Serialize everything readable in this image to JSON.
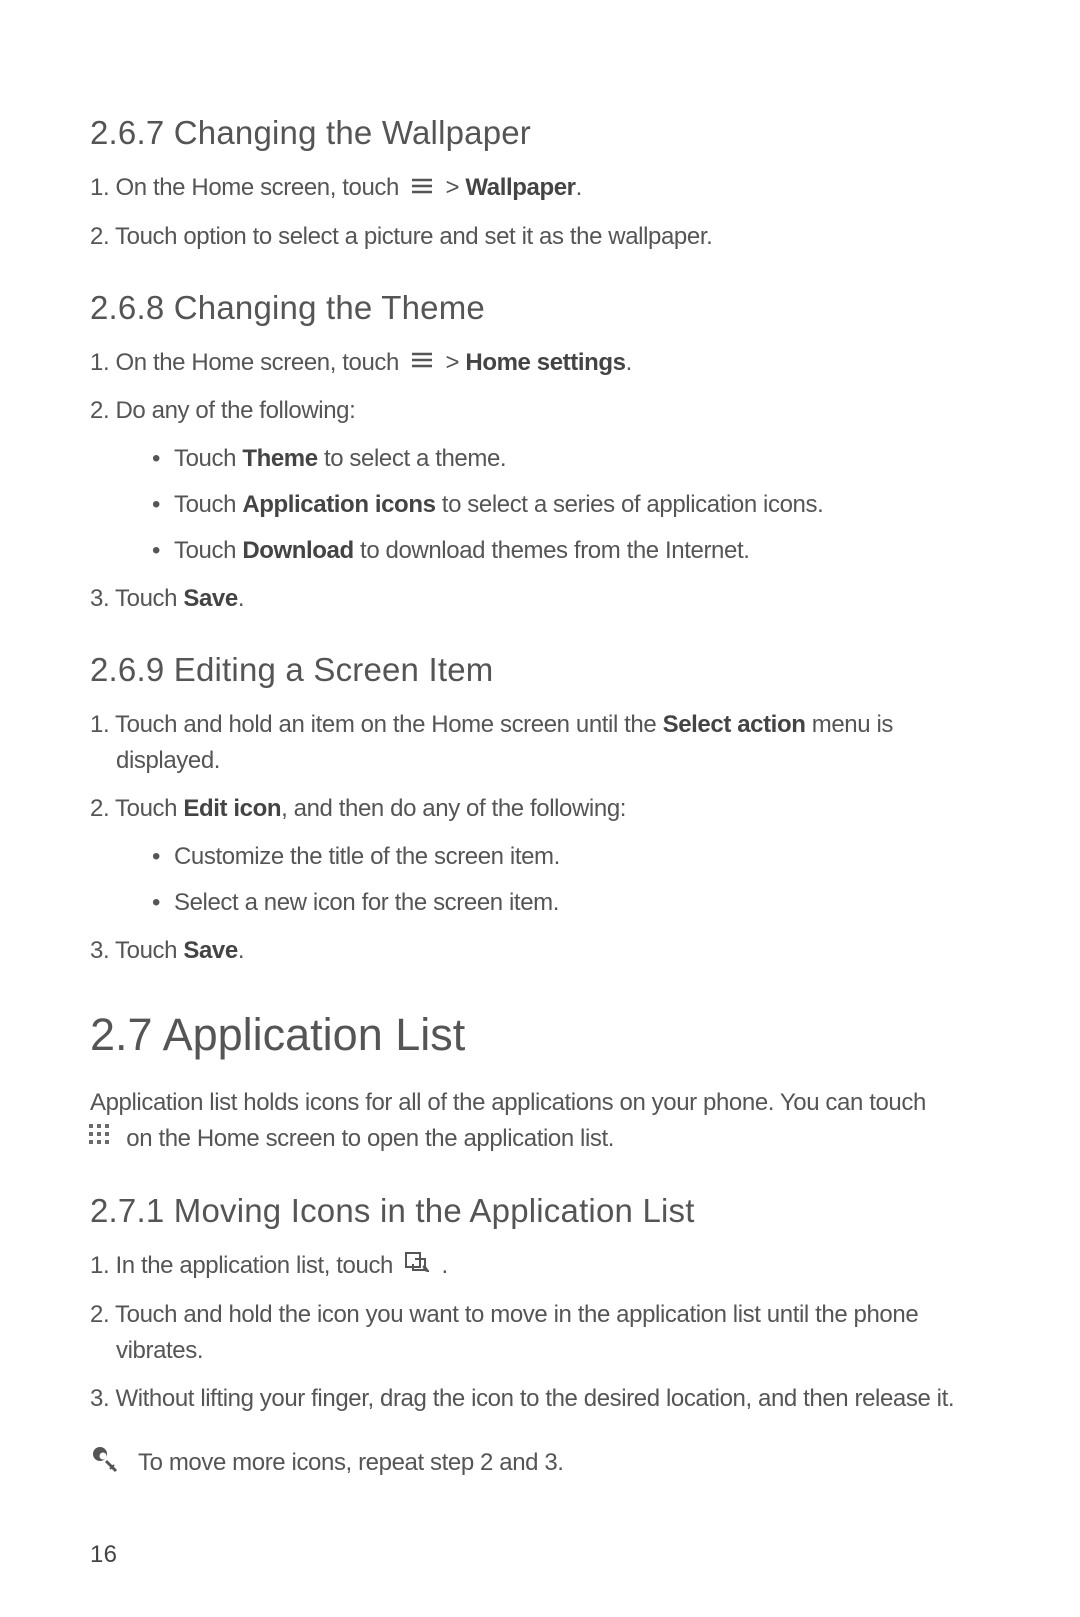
{
  "s267": {
    "heading": "2.6.7  Changing the Wallpaper",
    "step1_pre": "1. On the Home screen, touch ",
    "step1_post": " > ",
    "step1_bold": "Wallpaper",
    "step1_dot": ".",
    "step2": "2. Touch option to select a picture and set it as the wallpaper."
  },
  "s268": {
    "heading": "2.6.8  Changing the Theme",
    "step1_pre": "1. On the Home screen, touch ",
    "step1_post": " > ",
    "step1_bold": "Home settings",
    "step1_dot": ".",
    "step2": "2. Do any of the following:",
    "bullets": [
      {
        "pre": "Touch ",
        "bold": "Theme",
        "post": " to select a theme."
      },
      {
        "pre": "Touch ",
        "bold": "Application icons",
        "post": " to select a series of application icons."
      },
      {
        "pre": "Touch ",
        "bold": "Download",
        "post": " to download themes from the Internet."
      }
    ],
    "step3_pre": "3. Touch ",
    "step3_bold": "Save",
    "step3_dot": "."
  },
  "s269": {
    "heading": "2.6.9  Editing a Screen Item",
    "step1_pre": "1. Touch and hold an item on the Home screen until the ",
    "step1_bold": "Select action",
    "step1_post": " menu is",
    "step1_line2": "displayed.",
    "step2_pre": "2. Touch ",
    "step2_bold": "Edit icon",
    "step2_post": ", and then do any of the following:",
    "bullets": [
      "Customize the title of the screen item.",
      "Select a new icon for the screen item."
    ],
    "step3_pre": "3. Touch ",
    "step3_bold": "Save",
    "step3_dot": "."
  },
  "s27": {
    "heading": "2.7  Application List",
    "para_line1": "Application list holds icons for all of the applications on your phone. You can touch",
    "para_line2": " on the Home screen to open the application list."
  },
  "s271": {
    "heading": "2.7.1  Moving Icons in the Application List",
    "step1_pre": "1. In the application list, touch ",
    "step1_dot": " .",
    "step2": "2. Touch and hold the icon you want to move in the application list until the phone",
    "step2_line2": "vibrates.",
    "step3": "3. Without lifting your finger, drag the icon to the desired location, and then release it."
  },
  "note": {
    "text": "To move more icons, repeat step 2 and 3."
  },
  "page_number": "16",
  "icons": {
    "menu": "menu-icon",
    "grid": "app-grid-icon",
    "move": "move-icon",
    "note": "note-icon"
  }
}
